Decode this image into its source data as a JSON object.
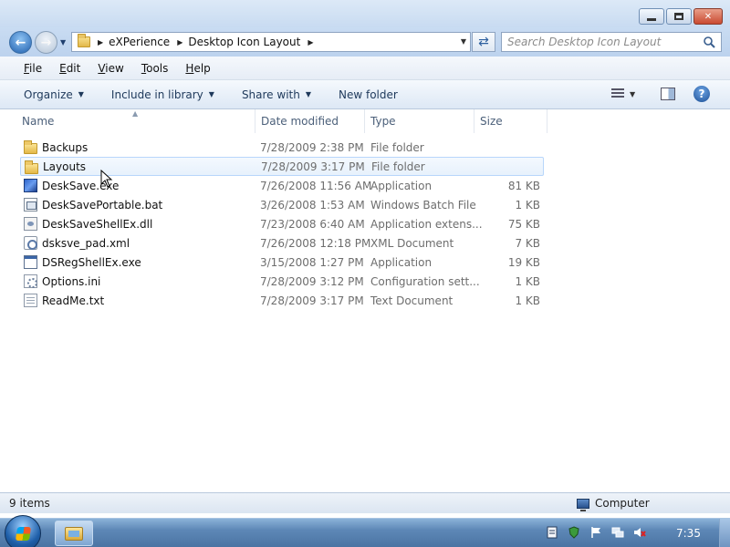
{
  "window": {
    "caption": {
      "minimize": "",
      "maximize": "",
      "close": "✕"
    }
  },
  "address": {
    "crumbs": [
      "eXPerience",
      "Desktop Icon Layout"
    ],
    "search_placeholder": "Search Desktop Icon Layout"
  },
  "menu": [
    "File",
    "Edit",
    "View",
    "Tools",
    "Help"
  ],
  "commands": {
    "organize": "Organize",
    "include_in_library": "Include in library",
    "share_with": "Share with",
    "new_folder": "New folder"
  },
  "columns": {
    "name": "Name",
    "date_modified": "Date modified",
    "type": "Type",
    "size": "Size"
  },
  "files": [
    {
      "name": "Backups",
      "date": "7/28/2009 2:38 PM",
      "type": "File folder",
      "size": "",
      "icon": "folder-icon"
    },
    {
      "name": "Layouts",
      "date": "7/28/2009 3:17 PM",
      "type": "File folder",
      "size": "",
      "icon": "folder-icon"
    },
    {
      "name": "DeskSave.exe",
      "date": "7/26/2008 11:56 AM",
      "type": "Application",
      "size": "81 KB",
      "icon": "application-icon"
    },
    {
      "name": "DeskSavePortable.bat",
      "date": "3/26/2008 1:53 AM",
      "type": "Windows Batch File",
      "size": "1 KB",
      "icon": "batch-file-icon"
    },
    {
      "name": "DeskSaveShellEx.dll",
      "date": "7/23/2008 6:40 AM",
      "type": "Application extens...",
      "size": "75 KB",
      "icon": "dll-file-icon"
    },
    {
      "name": "dsksve_pad.xml",
      "date": "7/26/2008 12:18 PM",
      "type": "XML Document",
      "size": "7 KB",
      "icon": "xml-file-icon"
    },
    {
      "name": "DSRegShellEx.exe",
      "date": "3/15/2008 1:27 PM",
      "type": "Application",
      "size": "19 KB",
      "icon": "application-window-icon"
    },
    {
      "name": "Options.ini",
      "date": "7/28/2009 3:12 PM",
      "type": "Configuration sett...",
      "size": "1 KB",
      "icon": "settings-file-icon"
    },
    {
      "name": "ReadMe.txt",
      "date": "7/28/2009 3:17 PM",
      "type": "Text Document",
      "size": "1 KB",
      "icon": "text-file-icon"
    }
  ],
  "hovered_file": "Layouts",
  "status": {
    "item_count": "9 items",
    "zone": "Computer"
  },
  "taskbar": {
    "clock": "7:35"
  },
  "colors": {
    "accent": "#1e395b",
    "hover_border": "#b8d6fb",
    "close_button": "#c94a31"
  }
}
